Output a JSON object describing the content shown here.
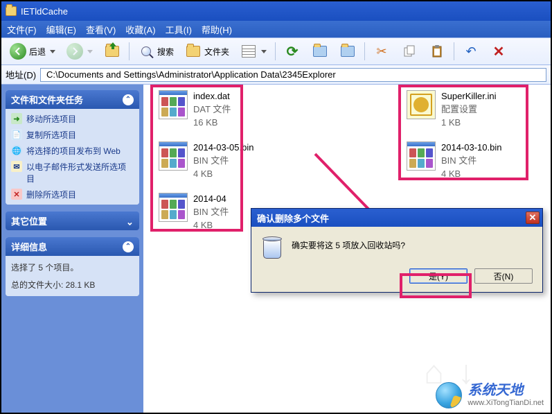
{
  "window": {
    "title": "IETldCache"
  },
  "menu": {
    "file": "文件(F)",
    "edit": "编辑(E)",
    "view": "查看(V)",
    "favorites": "收藏(A)",
    "tools": "工具(I)",
    "help": "帮助(H)"
  },
  "toolbar": {
    "back": "后退",
    "search": "搜索",
    "folders": "文件夹"
  },
  "address": {
    "label": "地址(D)",
    "path": "C:\\Documents and Settings\\Administrator\\Application Data\\2345Explorer"
  },
  "sidebar": {
    "tasks": {
      "title": "文件和文件夹任务",
      "items": [
        {
          "id": "move",
          "label": "移动所选项目"
        },
        {
          "id": "copy",
          "label": "复制所选项目"
        },
        {
          "id": "publish",
          "label": "将选择的项目发布到 Web"
        },
        {
          "id": "email",
          "label": "以电子邮件形式发送所选项目"
        },
        {
          "id": "delete",
          "label": "删除所选项目"
        }
      ]
    },
    "other": {
      "title": "其它位置"
    },
    "details": {
      "title": "详细信息",
      "line1": "选择了 5 个项目。",
      "line2": "总的文件大小: 28.1 KB"
    }
  },
  "files": [
    {
      "name": "index.dat",
      "type": "DAT 文件",
      "size": "16 KB",
      "icon": "grid"
    },
    {
      "name": "SuperKiller.ini",
      "type": "配置设置",
      "size": "1 KB",
      "icon": "gear"
    },
    {
      "name": "2014-03-05.bin",
      "type": "BIN 文件",
      "size": "4 KB",
      "icon": "grid"
    },
    {
      "name": "2014-03-10.bin",
      "type": "BIN 文件",
      "size": "4 KB",
      "icon": "grid"
    },
    {
      "name": "2014-04",
      "type": "BIN 文件",
      "size": "4 KB",
      "icon": "grid"
    }
  ],
  "dialog": {
    "title": "确认删除多个文件",
    "message": "确实要将这 5 项放入回收站吗?",
    "yes": "是(Y)",
    "no": "否(N)"
  },
  "watermark": {
    "cn": "系统天地",
    "en": "www.XiTongTianDi.net"
  }
}
